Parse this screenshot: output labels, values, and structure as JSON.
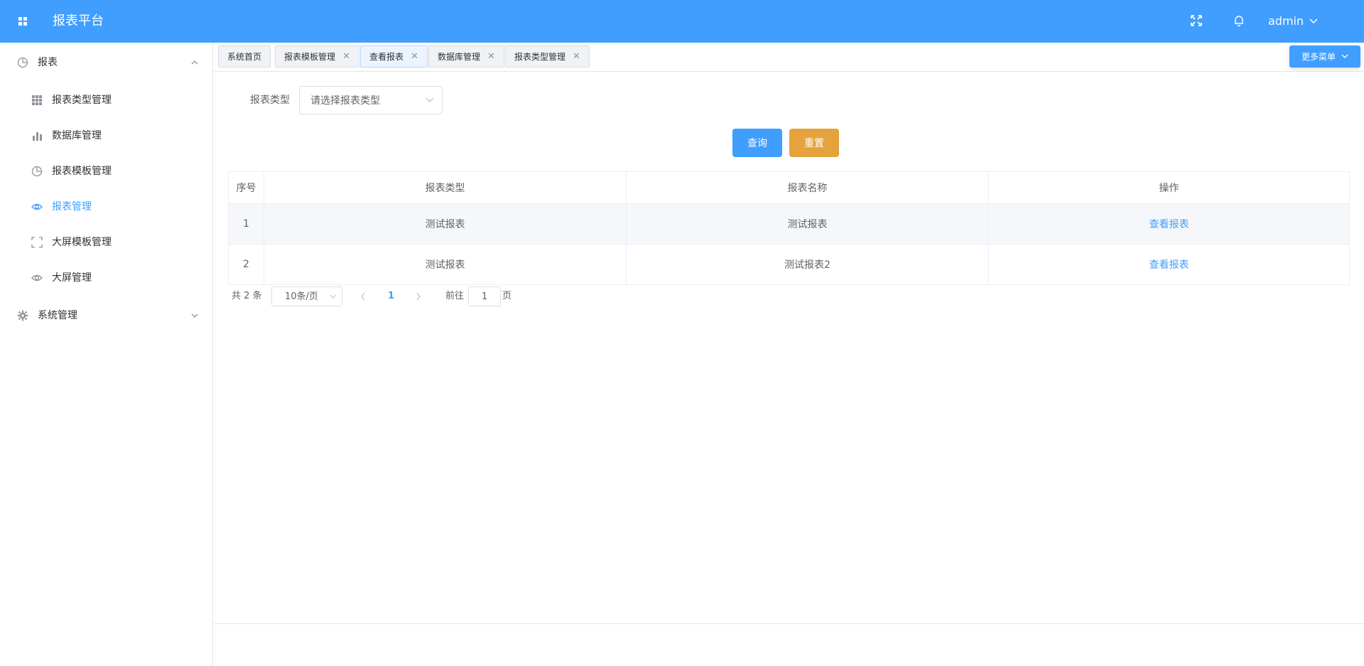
{
  "header": {
    "title": "报表平台",
    "user": "admin"
  },
  "sidebar": {
    "groups": [
      {
        "label": "报表",
        "expanded": true,
        "items": [
          {
            "label": "报表类型管理",
            "icon": "grid-icon"
          },
          {
            "label": "数据库管理",
            "icon": "bar-chart-icon"
          },
          {
            "label": "报表模板管理",
            "icon": "pie-chart-icon"
          },
          {
            "label": "报表管理",
            "icon": "eye-icon",
            "active": true
          },
          {
            "label": "大屏模板管理",
            "icon": "full-screen-icon"
          },
          {
            "label": "大屏管理",
            "icon": "eye-icon"
          }
        ]
      },
      {
        "label": "系统管理",
        "expanded": false
      }
    ]
  },
  "tabs": [
    {
      "label": "系统首页",
      "closable": false
    },
    {
      "label": "报表模板管理",
      "closable": true
    },
    {
      "label": "查看报表",
      "closable": true,
      "active": true
    },
    {
      "label": "数据库管理",
      "closable": true
    },
    {
      "label": "报表类型管理",
      "closable": true
    }
  ],
  "more_menu": "更多菜单",
  "filter": {
    "label": "报表类型",
    "placeholder": "请选择报表类型"
  },
  "buttons": {
    "query": "查询",
    "reset": "重置"
  },
  "table": {
    "headers": [
      "序号",
      "报表类型",
      "报表名称",
      "操作"
    ],
    "rows": [
      {
        "index": "1",
        "type": "测试报表",
        "name": "测试报表",
        "action": "查看报表"
      },
      {
        "index": "2",
        "type": "测试报表",
        "name": "测试报表2",
        "action": "查看报表"
      }
    ]
  },
  "pagination": {
    "total": "共 2 条",
    "page_size": "10条/页",
    "current_page": "1",
    "goto_label": "前往",
    "goto_value": "1",
    "page_suffix": "页"
  },
  "colors": {
    "primary": "#409eff",
    "warning": "#e6a23c"
  }
}
